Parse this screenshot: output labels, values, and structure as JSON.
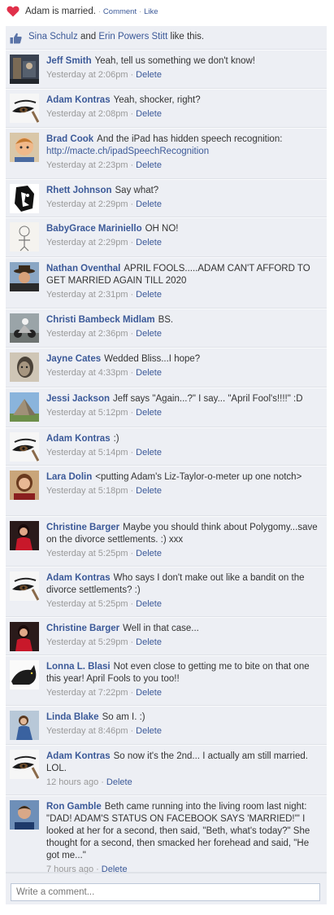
{
  "status": {
    "text": "Adam is married.",
    "comment_label": "Comment",
    "like_label": "Like",
    "separator": "·"
  },
  "likes": {
    "user1": "Sina Schulz",
    "connector": "and",
    "user2": "Erin Powers Stitt",
    "suffix": "like this."
  },
  "comments": [
    {
      "author": "Jeff Smith",
      "text": "Yeah, tell us something we don't know!",
      "time": "Yesterday at 2:06pm",
      "delete": "Delete",
      "avatar": "photo-dark"
    },
    {
      "author": "Adam Kontras",
      "text": "Yeah, shocker, right?",
      "time": "Yesterday at 2:08pm",
      "delete": "Delete",
      "avatar": "eye"
    },
    {
      "author": "Brad Cook",
      "text": "And the iPad has hidden speech recognition:",
      "url": "http://macte.ch/ipadSpeechRecognition",
      "time": "Yesterday at 2:23pm",
      "delete": "Delete",
      "avatar": "child"
    },
    {
      "author": "Rhett Johnson",
      "text": "Say what?",
      "time": "Yesterday at 2:29pm",
      "delete": "Delete",
      "avatar": "bw-face"
    },
    {
      "author": "BabyGrace Mariniello",
      "text": "OH NO!",
      "time": "Yesterday at 2:29pm",
      "delete": "Delete",
      "avatar": "sketch"
    },
    {
      "author": "Nathan Oventhal",
      "text": "APRIL FOOLS.....ADAM CAN'T AFFORD TO GET MARRIED AGAIN TILL 2020",
      "time": "Yesterday at 2:31pm",
      "delete": "Delete",
      "avatar": "hat-man"
    },
    {
      "author": "Christi Bambeck Midlam",
      "text": "BS.",
      "time": "Yesterday at 2:36pm",
      "delete": "Delete",
      "avatar": "motorbike"
    },
    {
      "author": "Jayne Cates",
      "text": "Wedded Bliss...I hope?",
      "time": "Yesterday at 4:33pm",
      "delete": "Delete",
      "avatar": "vintage"
    },
    {
      "author": "Jessi Jackson",
      "text": "Jeff says \"Again...?\" I say... \"April Fool's!!!!\" :D",
      "time": "Yesterday at 5:12pm",
      "delete": "Delete",
      "avatar": "pyramid"
    },
    {
      "author": "Adam Kontras",
      "text": ":)",
      "time": "Yesterday at 5:14pm",
      "delete": "Delete",
      "avatar": "eye"
    },
    {
      "author": "Lara Dolin",
      "text": "<putting Adam's Liz-Taylor-o-meter up one notch>",
      "time": "Yesterday at 5:18pm",
      "delete": "Delete",
      "avatar": "woman-brown"
    },
    {
      "author": "Christine Barger",
      "text": "Maybe you should think about Polygomy...save on the divorce settlements. :) xxx",
      "time": "Yesterday at 5:25pm",
      "delete": "Delete",
      "avatar": "woman-red"
    },
    {
      "author": "Adam Kontras",
      "text": "Who says I don't make out like a bandit on the divorce settlements? :)",
      "time": "Yesterday at 5:25pm",
      "delete": "Delete",
      "avatar": "eye"
    },
    {
      "author": "Christine Barger",
      "text": "Well in that case...",
      "time": "Yesterday at 5:29pm",
      "delete": "Delete",
      "avatar": "woman-red"
    },
    {
      "author": "Lonna L. Blasi",
      "text": "Not even close to getting me to bite on that one this year! April Fools to you too!!",
      "time": "Yesterday at 7:22pm",
      "delete": "Delete",
      "avatar": "cat"
    },
    {
      "author": "Linda Blake",
      "text": "So am I. :)",
      "time": "Yesterday at 8:46pm",
      "delete": "Delete",
      "avatar": "woman-blue"
    },
    {
      "author": "Adam Kontras",
      "text": "So now it's the 2nd... I actually am still married. LOL.",
      "time": "12 hours ago",
      "delete": "Delete",
      "avatar": "eye"
    },
    {
      "author": "Ron Gamble",
      "text": "Beth came running into the living room last night: \"DAD! ADAM'S STATUS ON FACEBOOK SAYS 'MARRIED!'\" I looked at her for a second, then said, \"Beth, what's today?\" She thought for a second, then smacked her forehead and said, \"He got me...\"",
      "time": "7 hours ago",
      "delete": "Delete",
      "avatar": "man-blue"
    }
  ],
  "compose": {
    "placeholder": "Write a comment..."
  },
  "colors": {
    "link": "#3b5998",
    "panel": "#edeff4",
    "meta": "#999999",
    "heart": "#e0304a"
  }
}
